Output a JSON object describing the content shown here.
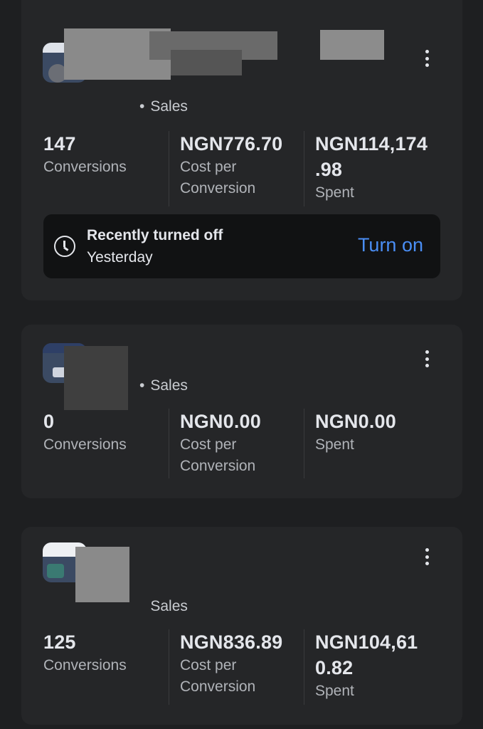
{
  "campaigns": [
    {
      "objective": "Sales",
      "metrics": [
        {
          "value": "147",
          "label": "Conversions"
        },
        {
          "value": "NGN776.70",
          "label": "Cost per\nConversion"
        },
        {
          "value": "NGN114,174\n.98",
          "label": "Spent"
        }
      ],
      "status": {
        "icon": "clock-icon",
        "title": "Recently turned off",
        "subtitle": "Yesterday",
        "action_label": "Turn on"
      }
    },
    {
      "objective": "Sales",
      "metrics": [
        {
          "value": "0",
          "label": "Conversions"
        },
        {
          "value": "NGN0.00",
          "label": "Cost per\nConversion"
        },
        {
          "value": "NGN0.00",
          "label": "Spent"
        }
      ]
    },
    {
      "objective": "Sales",
      "metrics": [
        {
          "value": "125",
          "label": "Conversions"
        },
        {
          "value": "NGN836.89",
          "label": "Cost per\nConversion"
        },
        {
          "value": "NGN104,61\n0.82",
          "label": "Spent"
        }
      ]
    }
  ],
  "icons": {
    "menu": "more-vertical-icon"
  },
  "colors": {
    "background": "#1e1f21",
    "card": "#252628",
    "accent": "#4a8ef5"
  }
}
